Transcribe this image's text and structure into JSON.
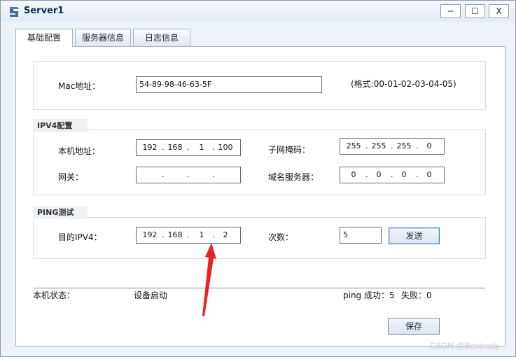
{
  "window": {
    "title": "Server1",
    "controls": {
      "minimize": "─",
      "maximize": "☐",
      "close": "X"
    }
  },
  "tabs": [
    {
      "label": "基础配置"
    },
    {
      "label": "服务器信息"
    },
    {
      "label": "日志信息"
    }
  ],
  "mac": {
    "label": "Mac地址：",
    "value": "54-89-98-46-63-5F",
    "hint": "(格式:00-01-02-03-04-05)"
  },
  "ipv4": {
    "section_label": "IPV4配置",
    "local_ip_label": "本机地址：",
    "local_ip": [
      "192",
      "168",
      "1",
      "100"
    ],
    "subnet_label": "子网掩码：",
    "subnet": [
      "255",
      "255",
      "255",
      "0"
    ],
    "gateway_label": "网关：",
    "gateway": [
      "",
      "",
      "",
      ""
    ],
    "dns_label": "域名服务器：",
    "dns": [
      "0",
      "0",
      "0",
      "0"
    ]
  },
  "ping": {
    "section_label": "PING测试",
    "dest_label": "目的IPV4：",
    "dest": [
      "192",
      "168",
      "1",
      "2"
    ],
    "count_label": "次数：",
    "count_value": "5",
    "send_label": "发送"
  },
  "status": {
    "label": "本机状态：",
    "value": "设备启动",
    "ping_success_label": "ping 成功：",
    "ping_success": "5",
    "fail_label": "失败：",
    "fail": "0"
  },
  "save_label": "保存",
  "watermark": "CSDN @Besteady",
  "colors": {
    "annotation_arrow": "#e8231f",
    "focus_border": "#3c7fc6"
  }
}
